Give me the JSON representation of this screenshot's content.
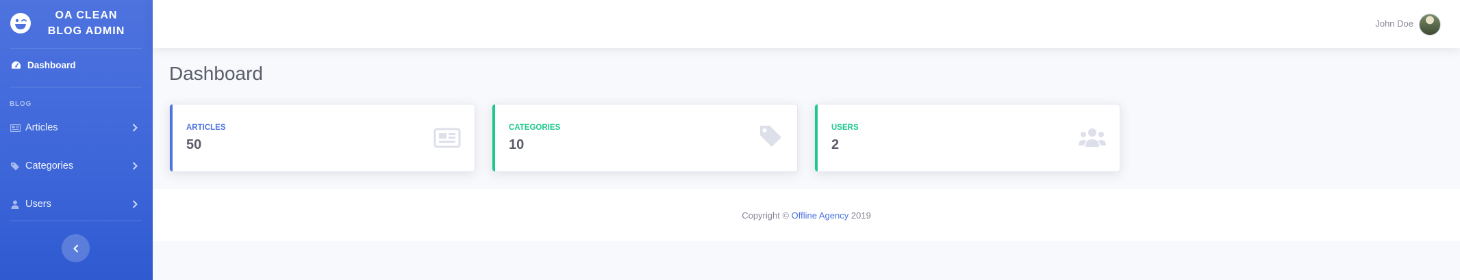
{
  "brand": {
    "line1": "OA CLEAN",
    "line2": "BLOG ADMIN",
    "logo_icon": "laugh-wink-icon"
  },
  "sidebar": {
    "dashboard_label": "Dashboard",
    "section_heading": "BLOG",
    "items": [
      {
        "label": "Articles",
        "icon": "newspaper-icon"
      },
      {
        "label": "Categories",
        "icon": "tags-icon"
      },
      {
        "label": "Users",
        "icon": "user-icon"
      }
    ],
    "toggle_icon": "chevron-left-icon"
  },
  "topbar": {
    "user_name": "John Doe"
  },
  "main": {
    "title": "Dashboard",
    "cards": [
      {
        "label": "ARTICLES",
        "value": "50",
        "color": "#4e73df",
        "icon": "newspaper-icon"
      },
      {
        "label": "CATEGORIES",
        "value": "10",
        "color": "#1cc88a",
        "icon": "tag-icon"
      },
      {
        "label": "USERS",
        "value": "2",
        "color": "#1cc88a",
        "icon": "users-icon"
      }
    ]
  },
  "footer": {
    "prefix": "Copyright ©",
    "link": "Offline Agency",
    "year": "2019"
  },
  "colors": {
    "primary": "#4e73df",
    "success": "#1cc88a",
    "text": "#5a5c69",
    "muted": "#858796",
    "icon_gray": "#dddfeb"
  }
}
